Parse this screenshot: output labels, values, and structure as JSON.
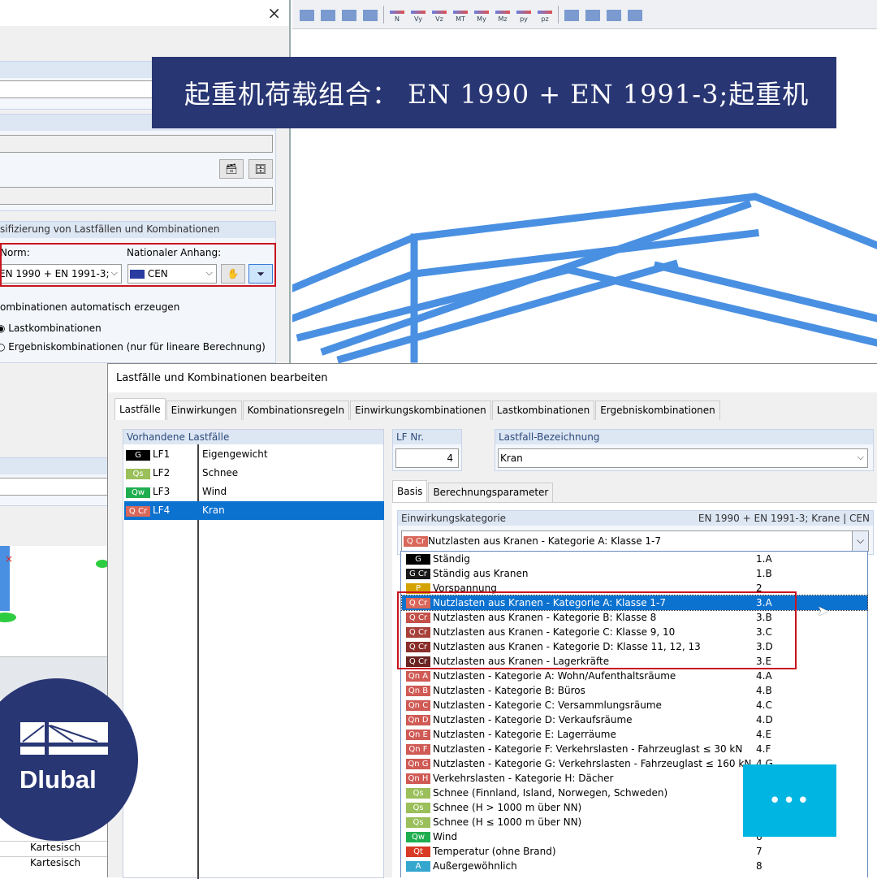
{
  "banner": {
    "title": "起重机荷载组合： EN 1990 + EN 1991-3;起重机"
  },
  "toolbar": {
    "icons": [
      "display-icon",
      "render-icon",
      "member-icon",
      "section-icon",
      "N",
      "Vy",
      "Vz",
      "MT",
      "My",
      "Mz",
      "py",
      "pz",
      "support-icon",
      "deformation-icon",
      "table-icon",
      "report-icon"
    ]
  },
  "left_dialog": {
    "close": "×",
    "classification_header": "sifizierung von Lastfällen und Kombinationen",
    "norm_label": "Norm:",
    "norm_value": "EN 1990 + EN 1991-3;",
    "annex_label": "Nationaler Anhang:",
    "annex_value": "CEN",
    "auto_generate": "ombinationen automatisch erzeugen",
    "radio_load_combos": "Lastkombinationen",
    "radio_result_combos": "Ergebniskombinationen (nur für lineare Berechnung)",
    "table_values": [
      "Kartesisch",
      "Kartesisch",
      "Kartesisch"
    ]
  },
  "main_dialog": {
    "title": "Lastfälle und Kombinationen bearbeiten",
    "tabs": [
      "Lastfälle",
      "Einwirkungen",
      "Kombinationsregeln",
      "Einwirkungskombinationen",
      "Lastkombinationen",
      "Ergebniskombinationen"
    ],
    "list_header": "Vorhandene Lastfälle",
    "load_cases": [
      {
        "badge": "G",
        "color": "#000000",
        "id": "LF1",
        "name": "Eigengewicht"
      },
      {
        "badge": "Qs",
        "color": "#9bbf5a",
        "id": "LF2",
        "name": "Schnee"
      },
      {
        "badge": "Qw",
        "color": "#1fae4f",
        "id": "LF3",
        "name": "Wind"
      },
      {
        "badge": "Q Cr",
        "color": "#d9675a",
        "id": "LF4",
        "name": "Kran",
        "selected": true
      }
    ],
    "lf_nr_label": "LF Nr.",
    "lf_nr_value": "4",
    "designation_label": "Lastfall-Bezeichnung",
    "designation_value": "Kran",
    "subtabs": [
      "Basis",
      "Berechnungsparameter"
    ],
    "category_label": "Einwirkungskategorie",
    "category_norm": "EN 1990 + EN 1991-3; Krane | CEN",
    "category_selected": {
      "badge": "Q Cr",
      "text": "Nutzlasten aus Kranen - Kategorie A: Klasse 1-7"
    },
    "category_options": [
      {
        "badge": "G",
        "color": "#000000",
        "text": "Ständig",
        "code": "1.A"
      },
      {
        "badge": "G Cr",
        "color": "#1a1a1a",
        "text": "Ständig aus Kranen",
        "code": "1.B"
      },
      {
        "badge": "P",
        "color": "#d4a300",
        "text": "Vorspannung",
        "code": "2"
      },
      {
        "badge": "Q Cr",
        "color": "#d9675a",
        "text": "Nutzlasten aus Kranen - Kategorie A: Klasse 1-7",
        "code": "3.A",
        "selected": true
      },
      {
        "badge": "Q Cr",
        "color": "#c4514a",
        "text": "Nutzlasten aus Kranen - Kategorie B: Klasse 8",
        "code": "3.B"
      },
      {
        "badge": "Q Cr",
        "color": "#a8403a",
        "text": "Nutzlasten aus Kranen - Kategorie C: Klasse 9, 10",
        "code": "3.C"
      },
      {
        "badge": "Q Cr",
        "color": "#8a2e2a",
        "text": "Nutzlasten aus Kranen - Kategorie D: Klasse 11, 12, 13",
        "code": "3.D"
      },
      {
        "badge": "Q Cr",
        "color": "#6a2320",
        "text": "Nutzlasten aus Kranen - Lagerkräfte",
        "code": "3.E"
      },
      {
        "badge": "Qn A",
        "color": "#d05a55",
        "text": "Nutzlasten - Kategorie A: Wohn/Aufenthaltsräume",
        "code": "4.A"
      },
      {
        "badge": "Qn B",
        "color": "#d05a55",
        "text": "Nutzlasten - Kategorie B: Büros",
        "code": "4.B"
      },
      {
        "badge": "Qn C",
        "color": "#d05a55",
        "text": "Nutzlasten - Kategorie C: Versammlungsräume",
        "code": "4.C"
      },
      {
        "badge": "Qn D",
        "color": "#d05a55",
        "text": "Nutzlasten - Kategorie D: Verkaufsräume",
        "code": "4.D"
      },
      {
        "badge": "Qn E",
        "color": "#d05a55",
        "text": "Nutzlasten - Kategorie E: Lagerräume",
        "code": "4.E"
      },
      {
        "badge": "Qn F",
        "color": "#d05a55",
        "text": "Nutzlasten - Kategorie F: Verkehrslasten - Fahrzeuglast ≤ 30 kN",
        "code": "4.F"
      },
      {
        "badge": "Qn G",
        "color": "#d05a55",
        "text": "Nutzlasten - Kategorie G: Verkehrslasten - Fahrzeuglast ≤ 160 kN",
        "code": "4.G"
      },
      {
        "badge": "Qn H",
        "color": "#d05a55",
        "text": "Verkehrslasten - Kategorie H: Dächer",
        "code": ""
      },
      {
        "badge": "Qs",
        "color": "#9bbf5a",
        "text": "Schnee (Finnland, Island, Norwegen, Schweden)",
        "code": ""
      },
      {
        "badge": "Qs",
        "color": "#9bbf5a",
        "text": "Schnee (H > 1000 m über NN)",
        "code": ""
      },
      {
        "badge": "Qs",
        "color": "#9bbf5a",
        "text": "Schnee (H ≤ 1000 m über NN)",
        "code": ""
      },
      {
        "badge": "Qw",
        "color": "#1fae4f",
        "text": "Wind",
        "code": "6"
      },
      {
        "badge": "Qt",
        "color": "#d93a26",
        "text": "Temperatur (ohne Brand)",
        "code": "7"
      },
      {
        "badge": "A",
        "color": "#35a7cf",
        "text": "Außergewöhnlich",
        "code": "8"
      }
    ]
  },
  "logo": {
    "text": "Dlubal"
  },
  "more_button": {
    "label": "•••"
  },
  "colors": {
    "banner": "#293674",
    "highlight": "#c8141e",
    "selection": "#0c72d0",
    "more": "#00b5e2"
  }
}
